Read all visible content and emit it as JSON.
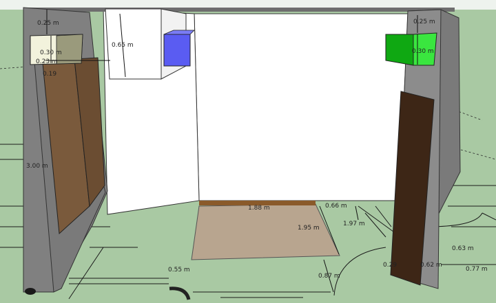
{
  "dimensions": {
    "top_left_gap": "0.25 m",
    "left_box_height": "0.30 m",
    "left_box_offset": "0.23 m",
    "left_small": "0.19",
    "upper_box_height": "0.65 m",
    "right_box_top": "0.25 m",
    "right_box_height": "0.30 m",
    "left_wall_height": "3.00 m",
    "floor_width": "1.88 m",
    "floor_depth": "1.95 m",
    "side_gap": "0.66 m",
    "right_depth": "1.97 m",
    "right_small_a": "0.63 m",
    "right_small_b": "0.77 m",
    "right_small_c": "0.62 m",
    "right_small_d": "0.29",
    "front_offset": "0.55 m",
    "front_depth": "0.87 m"
  },
  "colors": {
    "ground": "#a9c9a3",
    "wall_gray": "#808080",
    "wall_white": "#ffffff",
    "panel_brown": "#7a5a3c",
    "blue_box": "#5a5cf2",
    "green_box": "#16d21b",
    "floor": "#b8a58f"
  }
}
